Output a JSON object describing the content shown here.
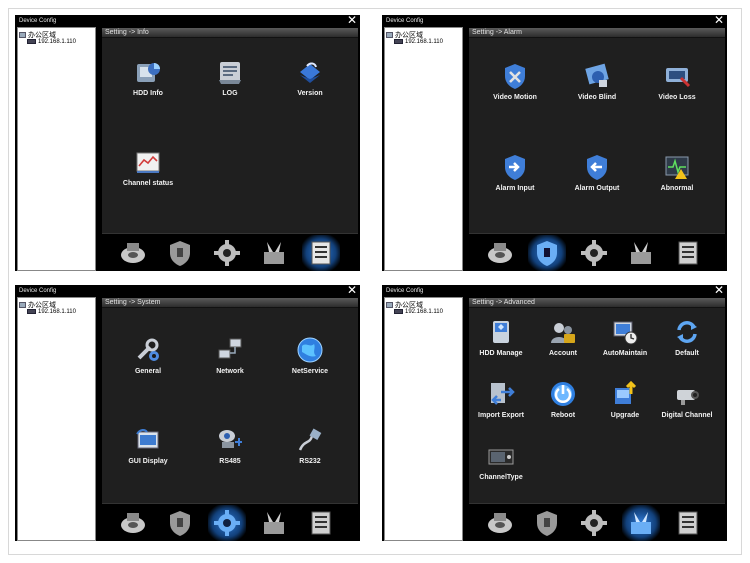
{
  "windows": [
    {
      "title": "Device Config",
      "tree_root": "办公区域",
      "tree_device": "192.168.1.110",
      "breadcrumb": "Setting -> Info",
      "active_tab": 4,
      "items": [
        {
          "label": "HDD Info",
          "icon": "hdd-info-icon"
        },
        {
          "label": "LOG",
          "icon": "log-icon"
        },
        {
          "label": "Version",
          "icon": "version-icon"
        },
        {
          "label": "Channel status",
          "icon": "channel-status-icon"
        }
      ]
    },
    {
      "title": "Device Config",
      "tree_root": "办公区域",
      "tree_device": "192.168.1.110",
      "breadcrumb": "Setting -> Alarm",
      "active_tab": 1,
      "items": [
        {
          "label": "Video Motion",
          "icon": "video-motion-icon"
        },
        {
          "label": "Video Blind",
          "icon": "video-blind-icon"
        },
        {
          "label": "Video Loss",
          "icon": "video-loss-icon"
        },
        {
          "label": "Alarm Input",
          "icon": "alarm-input-icon"
        },
        {
          "label": "Alarm Output",
          "icon": "alarm-output-icon"
        },
        {
          "label": "Abnormal",
          "icon": "abnormal-icon"
        }
      ]
    },
    {
      "title": "Device Config",
      "tree_root": "办公区域",
      "tree_device": "192.168.1.110",
      "breadcrumb": "Setting -> System",
      "active_tab": 2,
      "items": [
        {
          "label": "General",
          "icon": "general-icon"
        },
        {
          "label": "Network",
          "icon": "network-icon"
        },
        {
          "label": "NetService",
          "icon": "netservice-icon"
        },
        {
          "label": "GUI Display",
          "icon": "gui-display-icon"
        },
        {
          "label": "RS485",
          "icon": "rs485-icon"
        },
        {
          "label": "RS232",
          "icon": "rs232-icon"
        }
      ]
    },
    {
      "title": "Device Config",
      "tree_root": "办公区域",
      "tree_device": "192.168.1.110",
      "breadcrumb": "Setting -> Advanced",
      "active_tab": 3,
      "items": [
        {
          "label": "HDD Manage",
          "icon": "hdd-manage-icon"
        },
        {
          "label": "Account",
          "icon": "account-icon"
        },
        {
          "label": "AutoMaintain",
          "icon": "automaintain-icon"
        },
        {
          "label": "Default",
          "icon": "default-icon"
        },
        {
          "label": "Import Export",
          "icon": "import-export-icon"
        },
        {
          "label": "Reboot",
          "icon": "reboot-icon"
        },
        {
          "label": "Upgrade",
          "icon": "upgrade-icon"
        },
        {
          "label": "Digital Channel",
          "icon": "digital-channel-icon"
        },
        {
          "label": "ChannelType",
          "icon": "channel-type-icon"
        }
      ]
    }
  ],
  "bottom_tabs": [
    {
      "icon": "record-disk-icon"
    },
    {
      "icon": "alarm-shield-icon"
    },
    {
      "icon": "system-gear-icon"
    },
    {
      "icon": "advanced-tools-icon"
    },
    {
      "icon": "info-list-icon"
    }
  ],
  "colors": {
    "panel_bg": "#1f1f1f",
    "active_glow": "#2f7bd8",
    "label_text": "#f2f2f2"
  }
}
